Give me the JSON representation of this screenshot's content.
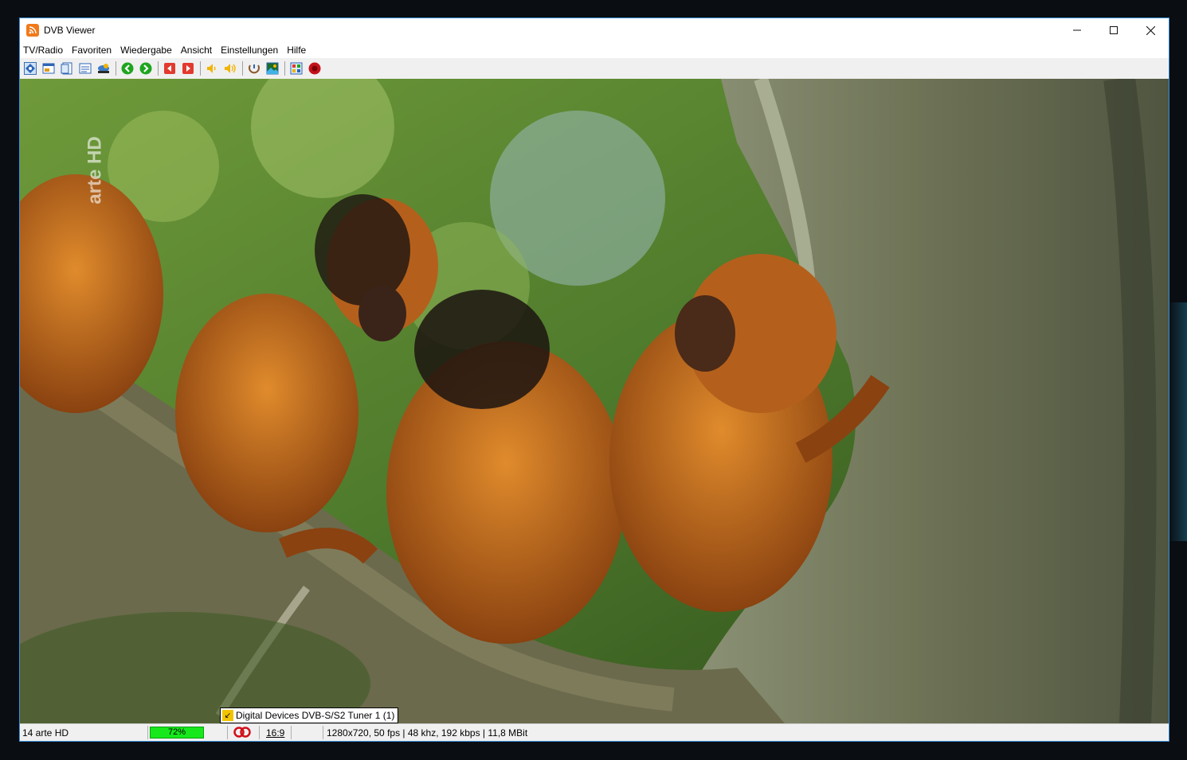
{
  "window": {
    "title": "DVB Viewer",
    "controls": {
      "minimize": "—",
      "maximize": "☐",
      "close": "✕"
    }
  },
  "menu": {
    "items": [
      {
        "label": "TV/Radio"
      },
      {
        "label": "Favoriten"
      },
      {
        "label": "Wiedergabe"
      },
      {
        "label": "Ansicht"
      },
      {
        "label": "Einstellungen"
      },
      {
        "label": "Hilfe"
      }
    ]
  },
  "toolbar": {
    "buttons": [
      "channel-list-icon",
      "osd-icon",
      "window-mode-icon",
      "teletext-icon",
      "epg-icon",
      "back-icon",
      "forward-icon",
      "previous-channel-icon",
      "next-channel-icon",
      "volume-down-icon",
      "volume-up-icon",
      "timeshift-icon",
      "snapshot-icon",
      "settings-icon",
      "record-icon"
    ],
    "colors": {
      "green": "#1ea51e",
      "red": "#e23a2e",
      "yellow": "#f1b400",
      "record": "#c4121a"
    }
  },
  "video": {
    "channel_logo": "arte HD"
  },
  "osd": {
    "tuner": "Digital Devices DVB-S/S2 Tuner 1 (1)"
  },
  "status": {
    "channel": "14 arte HD",
    "signal_label": "72%",
    "signal_percent": 72,
    "aspect": "16:9",
    "info": "1280x720, 50 fps | 48 khz, 192 kbps | 11,8 MBit"
  }
}
